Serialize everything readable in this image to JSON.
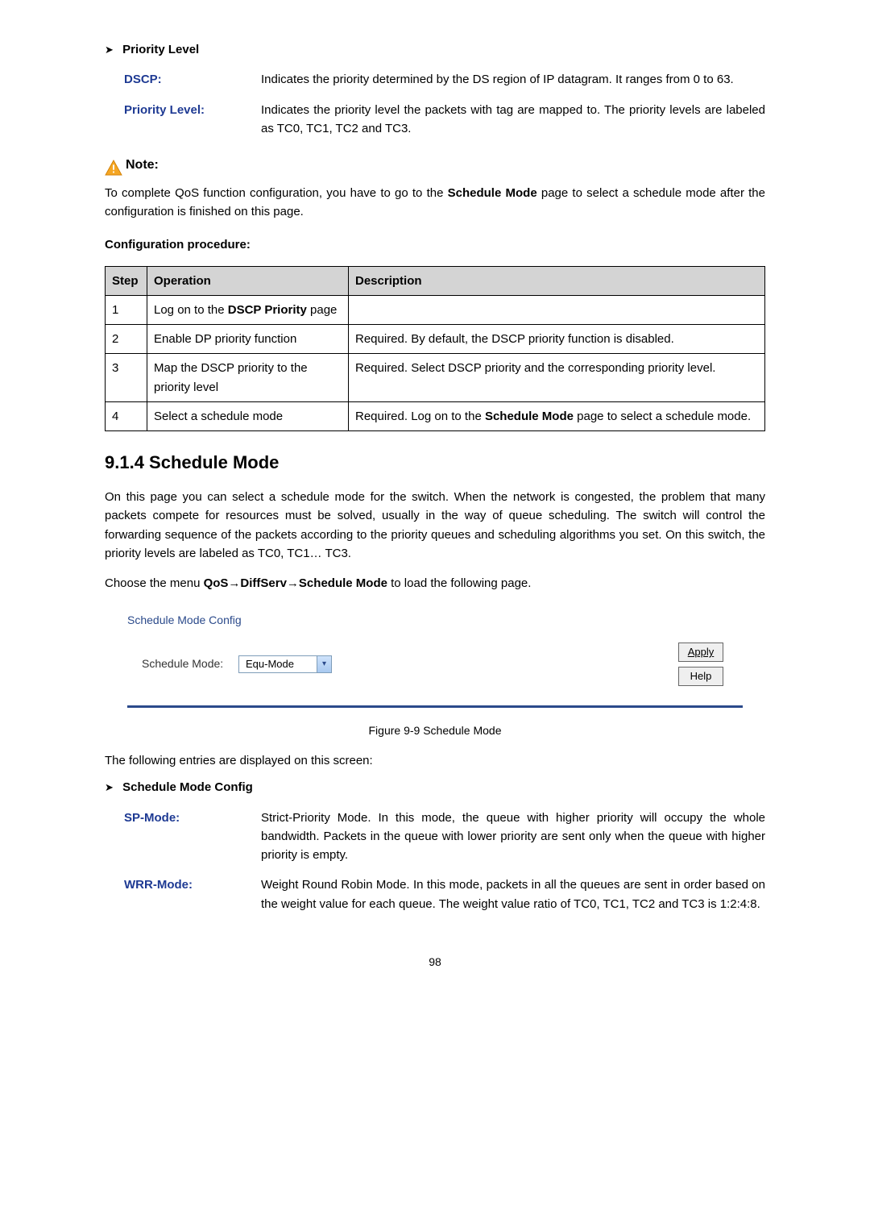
{
  "priority_level_section": {
    "heading": "Priority Level",
    "items": [
      {
        "term": "DSCP:",
        "desc": "Indicates the priority determined by the DS region of IP datagram. It ranges from 0 to 63."
      },
      {
        "term": "Priority Level:",
        "desc": "Indicates the priority level the packets with tag are mapped to. The priority levels are labeled as TC0, TC1, TC2 and TC3."
      }
    ]
  },
  "note": {
    "label": "Note:",
    "body_pre": "To complete QoS function configuration, you have to go to the ",
    "body_bold": "Schedule Mode",
    "body_post": " page to select a schedule mode after the configuration is finished on this page."
  },
  "conf_proc_heading": "Configuration procedure:",
  "proc_table": {
    "headers": {
      "step": "Step",
      "op": "Operation",
      "desc": "Description"
    },
    "rows": [
      {
        "step": "1",
        "op_pre": "Log on to the ",
        "op_bold": "DSCP Priority",
        "op_post": " page",
        "desc_pre": "",
        "desc_bold": "",
        "desc_post": ""
      },
      {
        "step": "2",
        "op_pre": "Enable DP priority function",
        "op_bold": "",
        "op_post": "",
        "desc_pre": "Required. By default, the DSCP priority function is disabled.",
        "desc_bold": "",
        "desc_post": ""
      },
      {
        "step": "3",
        "op_pre": "Map the DSCP priority to the priority level",
        "op_bold": "",
        "op_post": "",
        "desc_pre": "Required. Select DSCP priority and the corresponding priority level.",
        "desc_bold": "",
        "desc_post": ""
      },
      {
        "step": "4",
        "op_pre": "Select a schedule mode",
        "op_bold": "",
        "op_post": "",
        "desc_pre": "Required. Log on to the ",
        "desc_bold": "Schedule Mode",
        "desc_post": " page to select a schedule mode."
      }
    ]
  },
  "schedule_mode": {
    "heading": "9.1.4 Schedule Mode",
    "para1": "On this page you can select a schedule mode for the switch. When the network is congested, the problem that many packets compete for resources must be solved, usually in the way of queue scheduling. The switch will control the forwarding sequence of the packets according to the priority queues and scheduling algorithms you set. On this switch, the priority levels are labeled as TC0, TC1… TC3.",
    "nav_pre": "Choose the menu ",
    "nav_bold": "QoS→DiffServ→Schedule Mode",
    "nav_post": " to load the following page."
  },
  "figure": {
    "panel_title": "Schedule Mode Config",
    "label": "Schedule Mode:",
    "select_value": "Equ-Mode",
    "apply": "Apply",
    "help": "Help",
    "caption": "Figure 9-9 Schedule Mode"
  },
  "entries_intro": "The following entries are displayed on this screen:",
  "schedule_config": {
    "heading": "Schedule Mode Config",
    "items": [
      {
        "term": "SP-Mode:",
        "desc": "Strict-Priority Mode. In this mode, the queue with higher priority will occupy the whole bandwidth. Packets in the queue with lower priority are sent only when the queue with higher priority is empty."
      },
      {
        "term": "WRR-Mode:",
        "desc": "Weight Round Robin Mode. In this mode, packets in all the queues are sent in order based on the weight value for each queue. The weight value ratio of TC0, TC1, TC2 and TC3 is 1:2:4:8."
      }
    ]
  },
  "page_number": "98"
}
